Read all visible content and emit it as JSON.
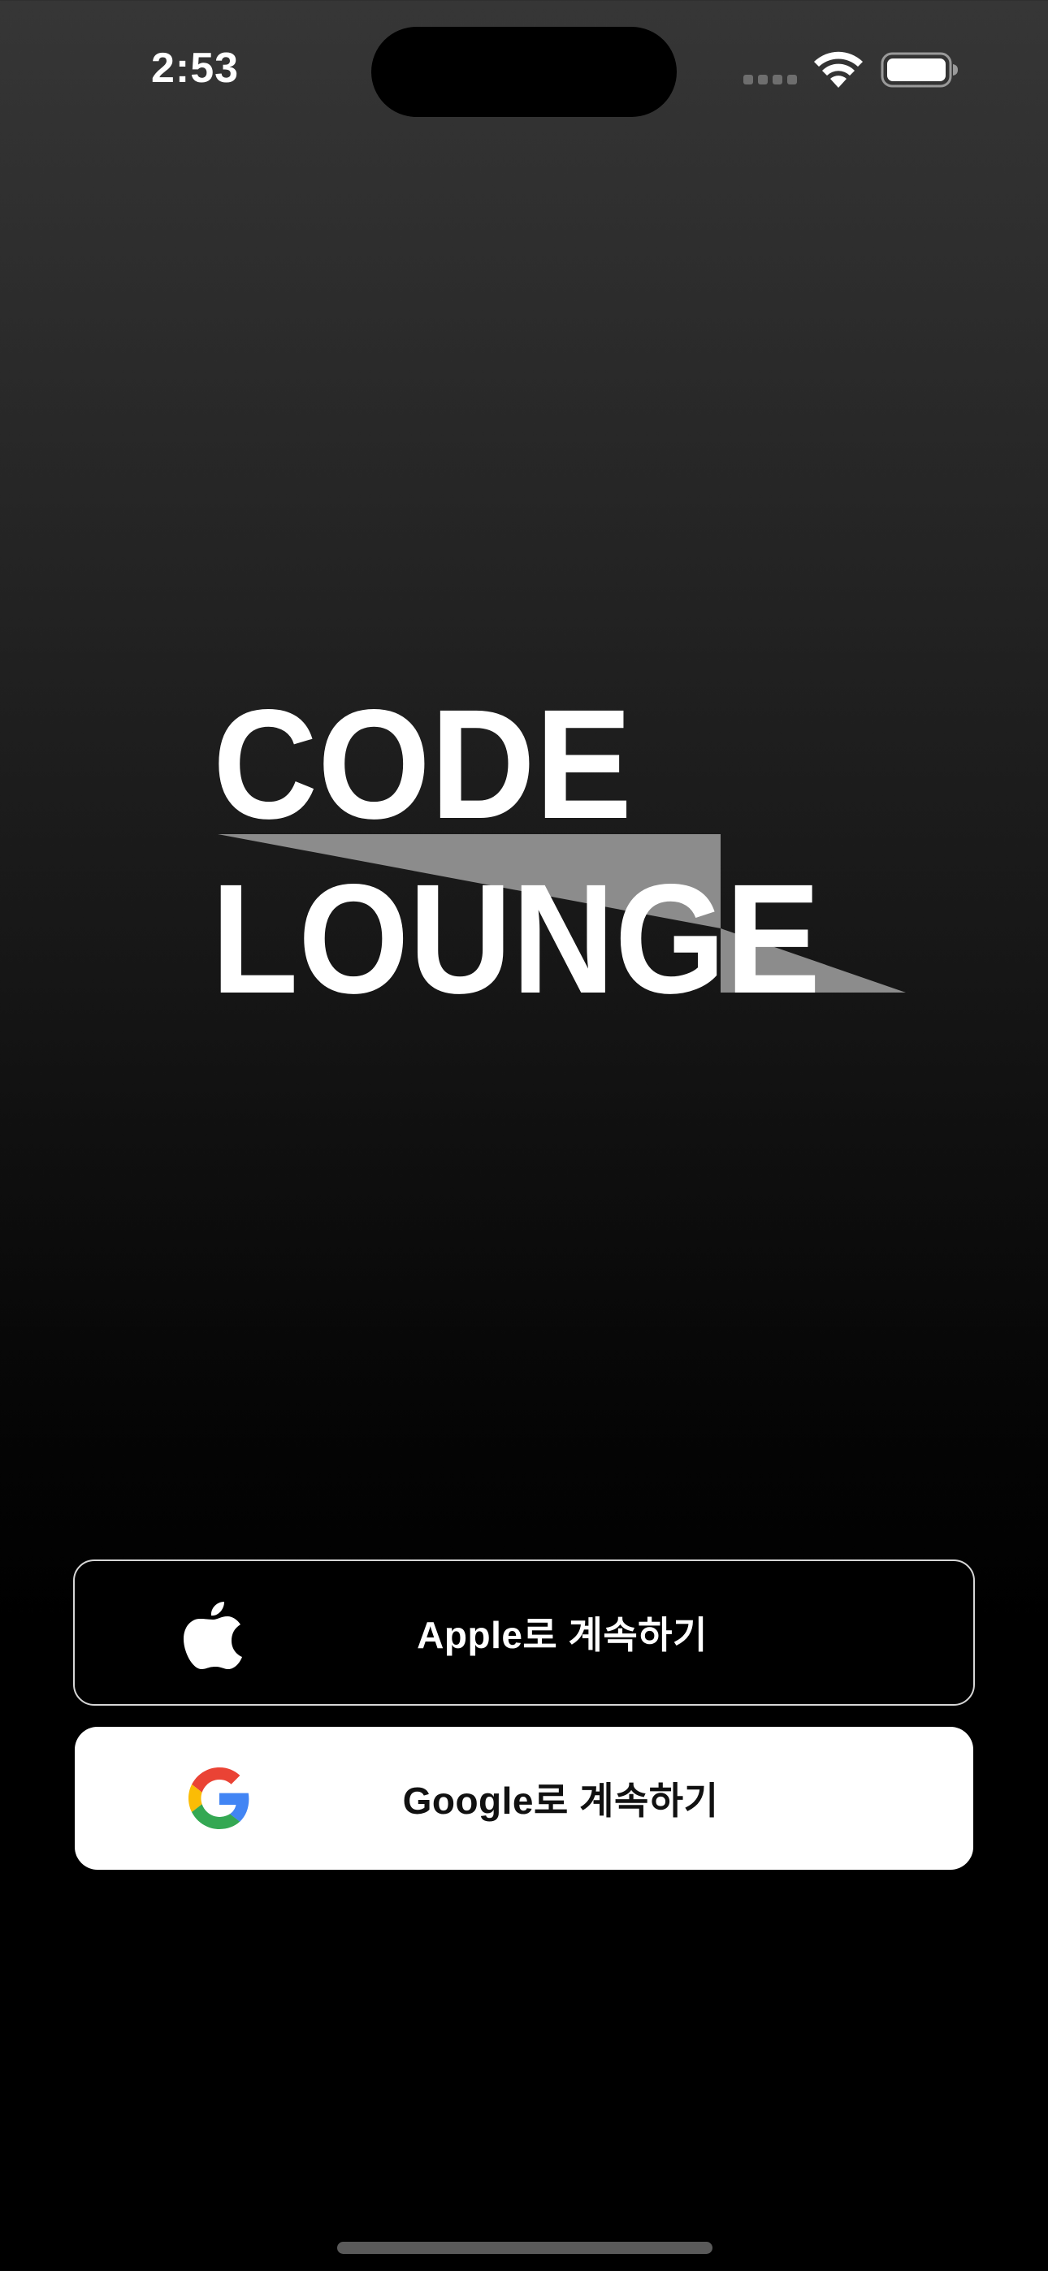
{
  "status_bar": {
    "time": "2:53",
    "icons": [
      "signal-icon",
      "wifi-icon",
      "battery-icon"
    ]
  },
  "logo": {
    "line1": "CODE",
    "line2": "LOUNGE",
    "text_color": "#ffffff",
    "accent_color": "#8c8c8c"
  },
  "login": {
    "apple": {
      "label": "Apple로 계속하기",
      "icon": "apple-icon"
    },
    "google": {
      "label": "Google로 계속하기",
      "icon": "google-icon"
    }
  },
  "colors": {
    "background_top": "#363636",
    "background_bottom": "#000000",
    "apple_button_bg": "#000000",
    "google_button_bg": "#ffffff",
    "google_blue": "#4285F4",
    "google_red": "#EA4335",
    "google_yellow": "#FBBC05",
    "google_green": "#34A853"
  }
}
